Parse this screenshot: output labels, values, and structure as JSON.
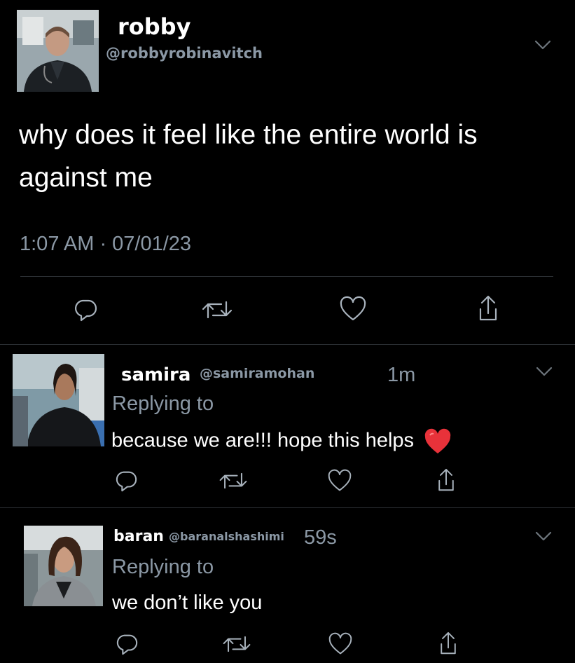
{
  "main_tweet": {
    "display_name": "robby",
    "handle": "@robbyrobinavitch",
    "text": "why does it feel like the entire world is against me",
    "timestamp": "1:07 AM · 07/01/23",
    "avatar_icon": "avatar-photo"
  },
  "replies": [
    {
      "display_name": "samira",
      "handle": "@samiramohan",
      "time": "1m",
      "replying_to": "Replying to",
      "text": "because we are!!! hope this helps",
      "emoji": "❤️"
    },
    {
      "display_name": "baran",
      "handle": "@baranalshashimi",
      "time": "59s",
      "replying_to": "Replying to",
      "text": "we don’t like you"
    }
  ],
  "actions": [
    "reply-icon",
    "retweet-icon",
    "like-icon",
    "share-icon"
  ],
  "colors": {
    "background": "#000000",
    "muted_text": "#8b98a5",
    "icon": "#a8b2bc",
    "divider": "#2b2f33",
    "heart": "#e0245e"
  }
}
